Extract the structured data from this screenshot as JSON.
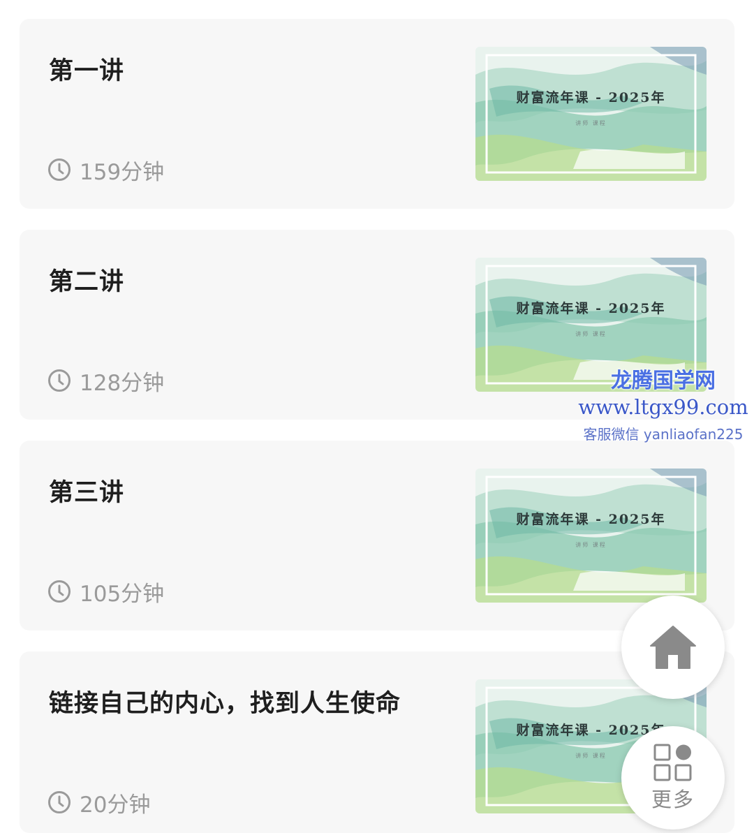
{
  "lessons": [
    {
      "title": "第一讲",
      "duration": "159分钟",
      "thumb_title": "财富流年课 - 2025年",
      "thumb_sub": "讲师 课程"
    },
    {
      "title": "第二讲",
      "duration": "128分钟",
      "thumb_title": "财富流年课 - 2025年",
      "thumb_sub": "讲师 课程"
    },
    {
      "title": "第三讲",
      "duration": "105分钟",
      "thumb_title": "财富流年课 - 2025年",
      "thumb_sub": "讲师 课程"
    },
    {
      "title": "链接自己的内心，找到人生使命",
      "duration": "20分钟",
      "thumb_title": "财富流年课 - 2025年",
      "thumb_sub": "讲师 课程"
    }
  ],
  "watermark": {
    "title": "龙腾国学网",
    "url": "www.ltgx99.com",
    "contact": "客服微信 yanliaofan225"
  },
  "fab": {
    "home_icon": "home-icon",
    "more_icon": "grid-icon",
    "more_label": "更多"
  },
  "colors": {
    "card_bg": "#f7f7f7",
    "title": "#1f1f1f",
    "meta": "#9a9a9a",
    "watermark": "#4a6fe3"
  }
}
